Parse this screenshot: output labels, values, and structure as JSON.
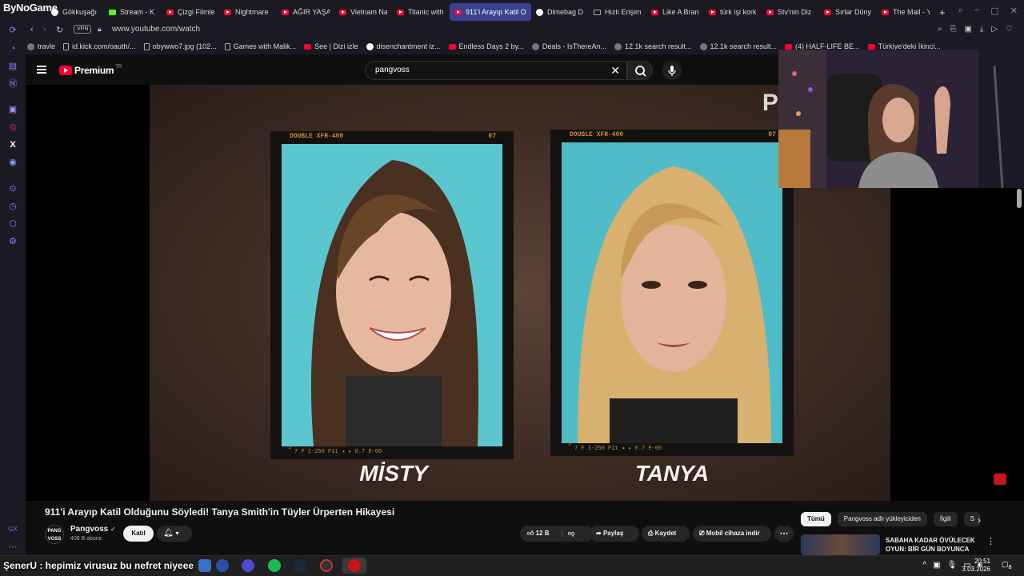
{
  "browser": {
    "brand": "ByNoGame",
    "tabs": [
      {
        "label": "Gökkuşağı",
        "icon": "generic"
      },
      {
        "label": "Stream - K",
        "icon": "kick"
      },
      {
        "label": "Çizgi Filmle",
        "icon": "youtube"
      },
      {
        "label": "Nightmare",
        "icon": "youtube"
      },
      {
        "label": "AĞIR YAŞA",
        "icon": "youtube"
      },
      {
        "label": "Vietnam Na",
        "icon": "youtube"
      },
      {
        "label": "Titanic with",
        "icon": "youtube"
      },
      {
        "label": "911'i Arayıp Katil Old",
        "icon": "youtube",
        "active": true
      },
      {
        "label": "Dimebag D",
        "icon": "google"
      },
      {
        "label": "Hızlı Erişim",
        "icon": "grid"
      },
      {
        "label": "Like A Bran",
        "icon": "youtube"
      },
      {
        "label": "türk işi kork",
        "icon": "youtube"
      },
      {
        "label": "Stv'nin Diz",
        "icon": "youtube"
      },
      {
        "label": "Sırlar Düny",
        "icon": "youtube"
      },
      {
        "label": "The Mall - Y",
        "icon": "youtube"
      }
    ],
    "new_tab": "+",
    "address": {
      "vpn": "VPN",
      "url": "www.youtube.com/watch"
    },
    "bookmarks": [
      {
        "label": "travle",
        "icon": "generic"
      },
      {
        "label": "id.kick.com/oauth/...",
        "icon": "file"
      },
      {
        "label": "obywwo7.jpg (102...",
        "icon": "file"
      },
      {
        "label": "Games with Malik...",
        "icon": "file"
      },
      {
        "label": "See | Dizi izle",
        "icon": "youtube"
      },
      {
        "label": "disenchantment iz...",
        "icon": "google"
      },
      {
        "label": "Endless Days 2 by...",
        "icon": "youtube"
      },
      {
        "label": "Deals - IsThereAn...",
        "icon": "generic"
      },
      {
        "label": "12.1k search result...",
        "icon": "generic"
      },
      {
        "label": "12.1k search result...",
        "icon": "generic"
      },
      {
        "label": "(4) HALF-LIFE BE...",
        "icon": "youtube"
      },
      {
        "label": "Türkiye'deki İkinci...",
        "icon": "youtube"
      }
    ]
  },
  "youtube": {
    "logo_text": "Premium",
    "country": "TR",
    "search_value": "pangvoss",
    "video": {
      "watermark": "PAN",
      "photos": [
        {
          "header_left": "DOUBLE XFR-400",
          "header_right": "07",
          "footer": "7 F 1-250 F11  ◂ ▸ 0.7 E-00",
          "frame_no": "5",
          "caption": "MİSTY"
        },
        {
          "header_left": "DOUBLE XFR-400",
          "header_right": "07",
          "footer": "7 F 1-250 F11  ◂ ▸ 0.7 E-00",
          "frame_no": "5",
          "caption": "TANYA"
        }
      ]
    },
    "title": "911'i Arayıp Katil Olduğunu Söyledi! Tanya Smith'in Tüyler Ürperten Hikayesi",
    "channel": {
      "avatar_text": "PANG VOSS",
      "name": "Pangvoss",
      "subs": "408 B abone",
      "join": "Katıl"
    },
    "actions": {
      "likes": "12 B",
      "share": "Paylaş",
      "save": "Kaydet",
      "download": "Mobil cihaza indir"
    },
    "filters": [
      "Tümü",
      "Pangvoss adlı yükleyiciden",
      "İlgili",
      "S"
    ],
    "recommendation": {
      "title": "SABAHA KADAR ÖVÜLECEK OYUN: BİR GÜN BOYUNCA GO..."
    }
  },
  "stream": {
    "chat_message": "ŞenerU : hepimiz virusuz bu nefret niyeee"
  },
  "taskbar": {
    "time": "20:51",
    "date": "3.03.2026",
    "notifications": "8"
  }
}
